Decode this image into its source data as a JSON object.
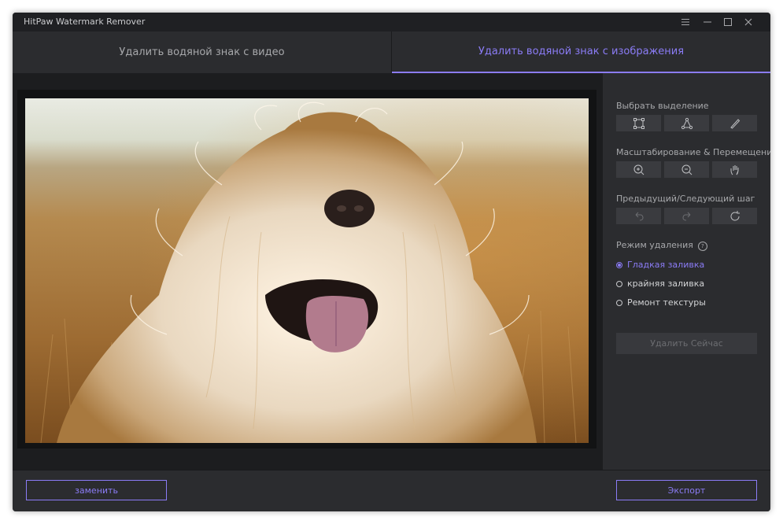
{
  "window": {
    "title": "HitPaw Watermark Remover",
    "controls": [
      "menu-icon",
      "minimize-icon",
      "maximize-icon",
      "close-icon"
    ]
  },
  "tabs": [
    {
      "label": "Удалить водяной знак с видео",
      "active": false
    },
    {
      "label": "Удалить водяной знак с изображения",
      "active": true
    }
  ],
  "colors": {
    "accent": "#8b7cf6",
    "background": "#2b2c2f",
    "workspace": "#1c1d1f",
    "text": "#a7a8ab"
  },
  "panel": {
    "select_label": "Выбрать выделение",
    "select_tools": [
      "rectangle-select-icon",
      "polygon-select-icon",
      "brush-icon"
    ],
    "zoom_label": "Масштабирование & Перемещение",
    "zoom_tools": [
      "zoom-in-icon",
      "zoom-out-icon",
      "hand-icon"
    ],
    "history_label": "Предыдущий/Следующий шаг",
    "history_tools": [
      "undo-icon",
      "redo-icon",
      "reset-icon"
    ],
    "mode_label": "Режим удаления",
    "modes": [
      {
        "label": "Гладкая заливка",
        "selected": true
      },
      {
        "label": "крайняя заливка",
        "selected": false
      },
      {
        "label": "Ремонт текстуры",
        "selected": false
      }
    ],
    "remove_button": "Удалить Сейчас"
  },
  "footer": {
    "replace_button": "заменить",
    "export_button": "Экспорт"
  }
}
